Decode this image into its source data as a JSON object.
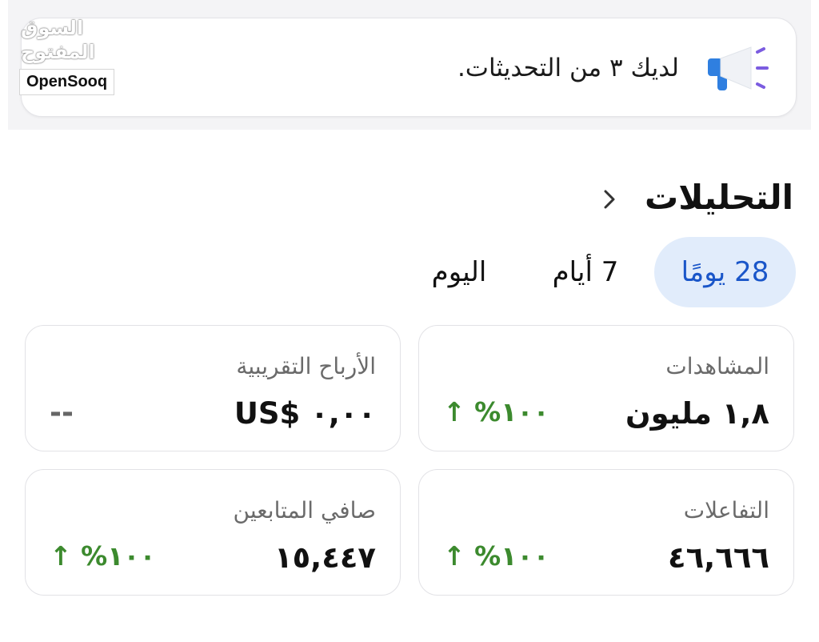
{
  "watermark": {
    "arabic": "السوق المفتوح",
    "brand": "OpenSooq"
  },
  "notice": {
    "icon": "megaphone-icon",
    "text": "لديك ٣ من التحديثات."
  },
  "analytics": {
    "title": "التحليلات",
    "chevron": "chevron-right-icon",
    "tabs": [
      {
        "label": "28 يومًا",
        "active": true
      },
      {
        "label": "7 أيام",
        "active": false
      },
      {
        "label": "اليوم",
        "active": false
      }
    ],
    "cards": {
      "views": {
        "label": "المشاهدات",
        "value": "١,٨ مليون",
        "change": "↑ %١٠٠"
      },
      "earnings": {
        "label": "الأرباح التقريبية",
        "value": "US$ ٠,٠٠",
        "change": "--"
      },
      "interactions": {
        "label": "التفاعلات",
        "value": "٤٦,٦٦٦",
        "change": "↑ %١٠٠"
      },
      "net_followers": {
        "label": "صافي المتابعين",
        "value": "١٥,٤٤٧",
        "change": "↑ %١٠٠"
      }
    }
  },
  "colors": {
    "accent": "#1a56c9",
    "active_tab_bg": "#e1ecfb",
    "positive": "#3c8a2e",
    "card_border": "#e2e2e6"
  }
}
